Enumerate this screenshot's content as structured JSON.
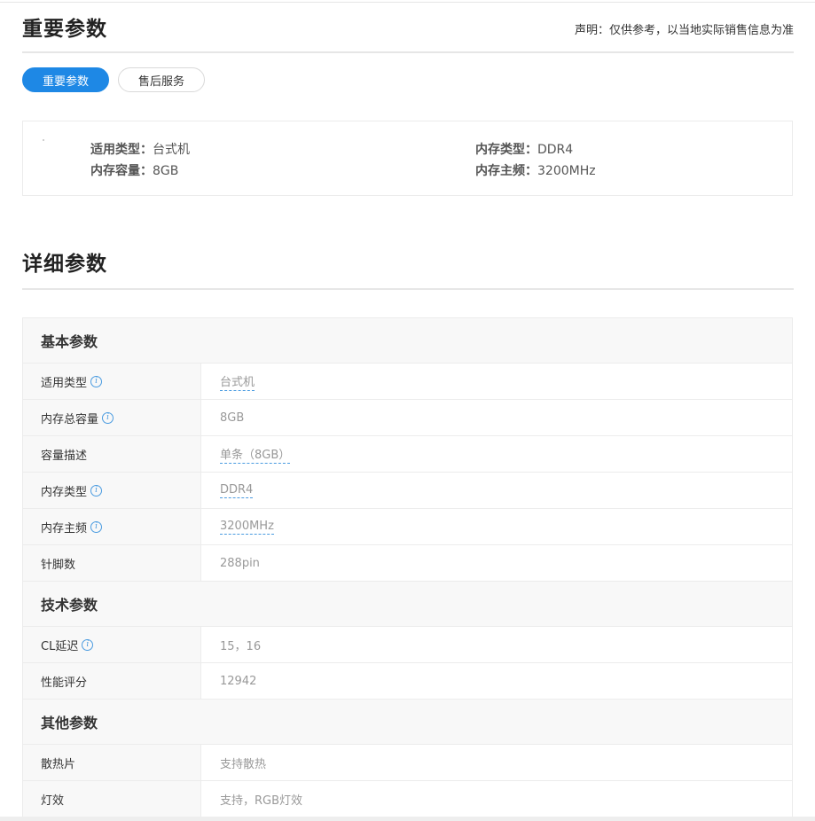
{
  "header": {
    "title": "重要参数",
    "disclaimer": "声明：仅供参考，以当地实际销售信息为准"
  },
  "tabs": [
    {
      "label": "重要参数",
      "active": true
    },
    {
      "label": "售后服务",
      "active": false
    }
  ],
  "key_params": [
    {
      "label": "适用类型：",
      "value": "台式机"
    },
    {
      "label": "内存类型：",
      "value": "DDR4"
    },
    {
      "label": "内存容量：",
      "value": "8GB"
    },
    {
      "label": "内存主频：",
      "value": "3200MHz"
    }
  ],
  "detail": {
    "title": "详细参数",
    "groups": [
      {
        "name": "基本参数",
        "rows": [
          {
            "name": "适用类型",
            "info": true,
            "value": "台式机",
            "link": true
          },
          {
            "name": "内存总容量",
            "info": true,
            "value": "8GB",
            "link": false
          },
          {
            "name": "容量描述",
            "info": false,
            "value": "单条（8GB）",
            "link": true
          },
          {
            "name": "内存类型",
            "info": true,
            "value": "DDR4",
            "link": true
          },
          {
            "name": "内存主频",
            "info": true,
            "value": "3200MHz",
            "link": true
          },
          {
            "name": "针脚数",
            "info": false,
            "value": "288pin",
            "link": false
          }
        ]
      },
      {
        "name": "技术参数",
        "rows": [
          {
            "name": "CL延迟",
            "info": true,
            "value": "15，16",
            "link": false
          },
          {
            "name": "性能评分",
            "info": false,
            "value": "12942",
            "link": false
          }
        ]
      },
      {
        "name": "其他参数",
        "rows": [
          {
            "name": "散热片",
            "info": false,
            "value": "支持散热",
            "link": false
          },
          {
            "name": "灯效",
            "info": false,
            "value": "支持，RGB灯效",
            "link": false
          }
        ]
      }
    ]
  },
  "icons": {
    "info": "info-icon"
  },
  "colors": {
    "accent": "#1e88e5",
    "link_underline": "#4a9be0"
  }
}
